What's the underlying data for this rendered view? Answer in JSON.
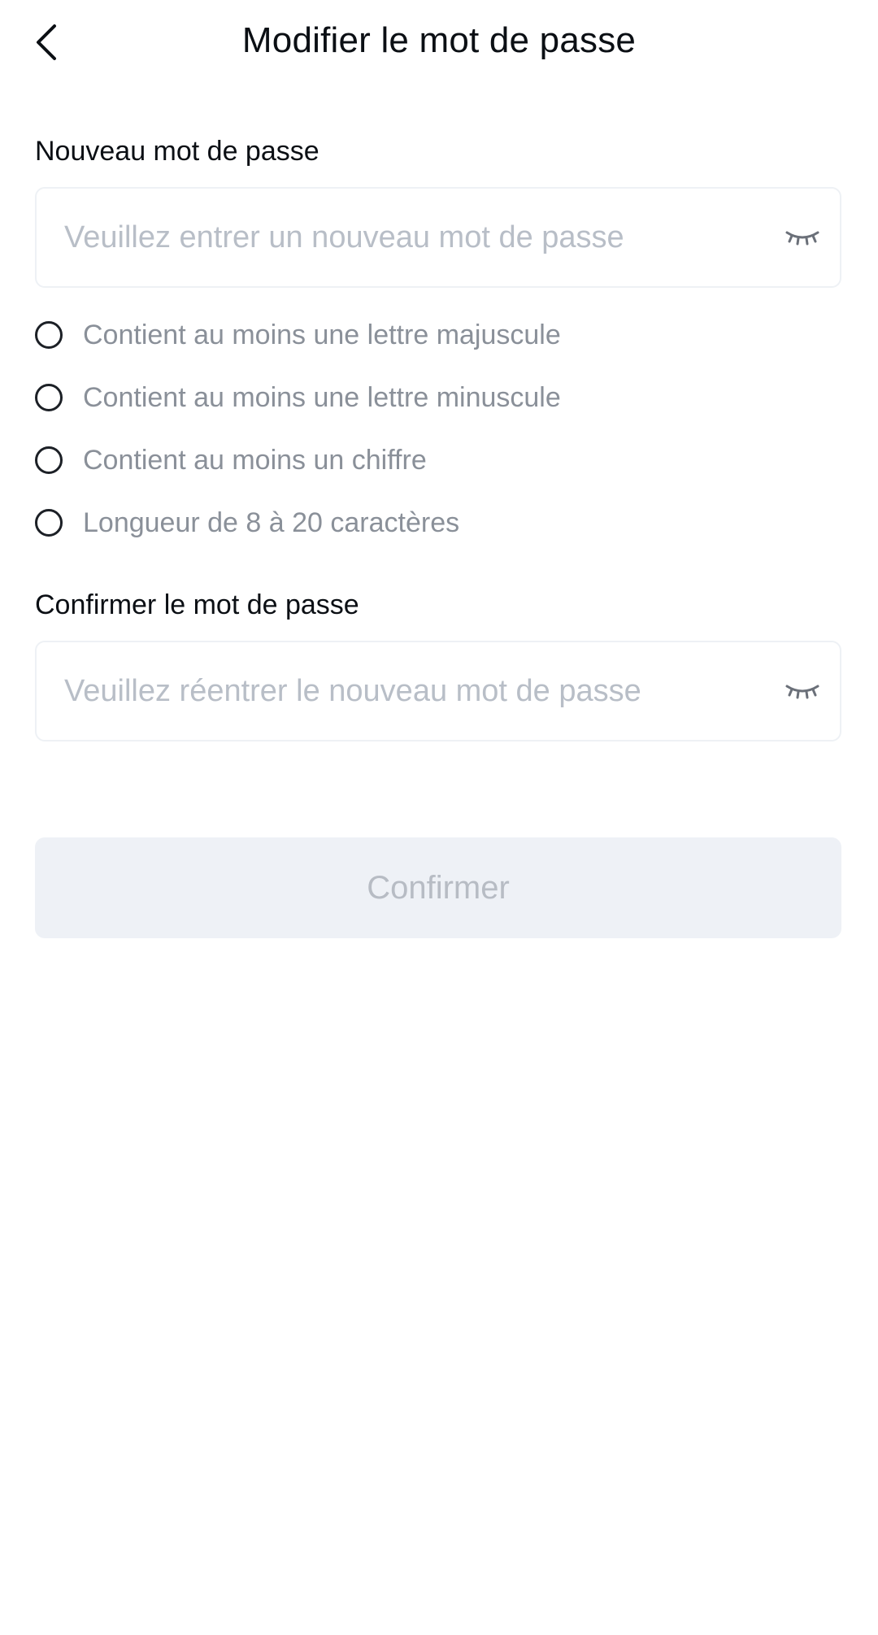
{
  "header": {
    "title": "Modifier le mot de passe",
    "back_icon": "chevron-left-icon"
  },
  "new_password": {
    "label": "Nouveau mot de passe",
    "placeholder": "Veuillez entrer un nouveau mot de passe",
    "value": "",
    "visibility_icon": "eye-closed-icon"
  },
  "rules": [
    {
      "label": "Contient au moins une lettre majuscule",
      "satisfied": false
    },
    {
      "label": "Contient au moins une lettre minuscule",
      "satisfied": false
    },
    {
      "label": "Contient au moins un chiffre",
      "satisfied": false
    },
    {
      "label": "Longueur de 8 à 20 caractères",
      "satisfied": false
    }
  ],
  "confirm_password": {
    "label": "Confirmer le mot de passe",
    "placeholder": "Veuillez réentrer le nouveau mot de passe",
    "value": "",
    "visibility_icon": "eye-closed-icon"
  },
  "submit": {
    "label": "Confirmer",
    "enabled": false
  },
  "colors": {
    "text_primary": "#0b0f14",
    "text_secondary": "#8a9099",
    "placeholder": "#b8bec7",
    "input_border": "#eef1f5",
    "button_disabled_bg": "#eef1f6",
    "button_disabled_text": "#b7bcc4"
  }
}
